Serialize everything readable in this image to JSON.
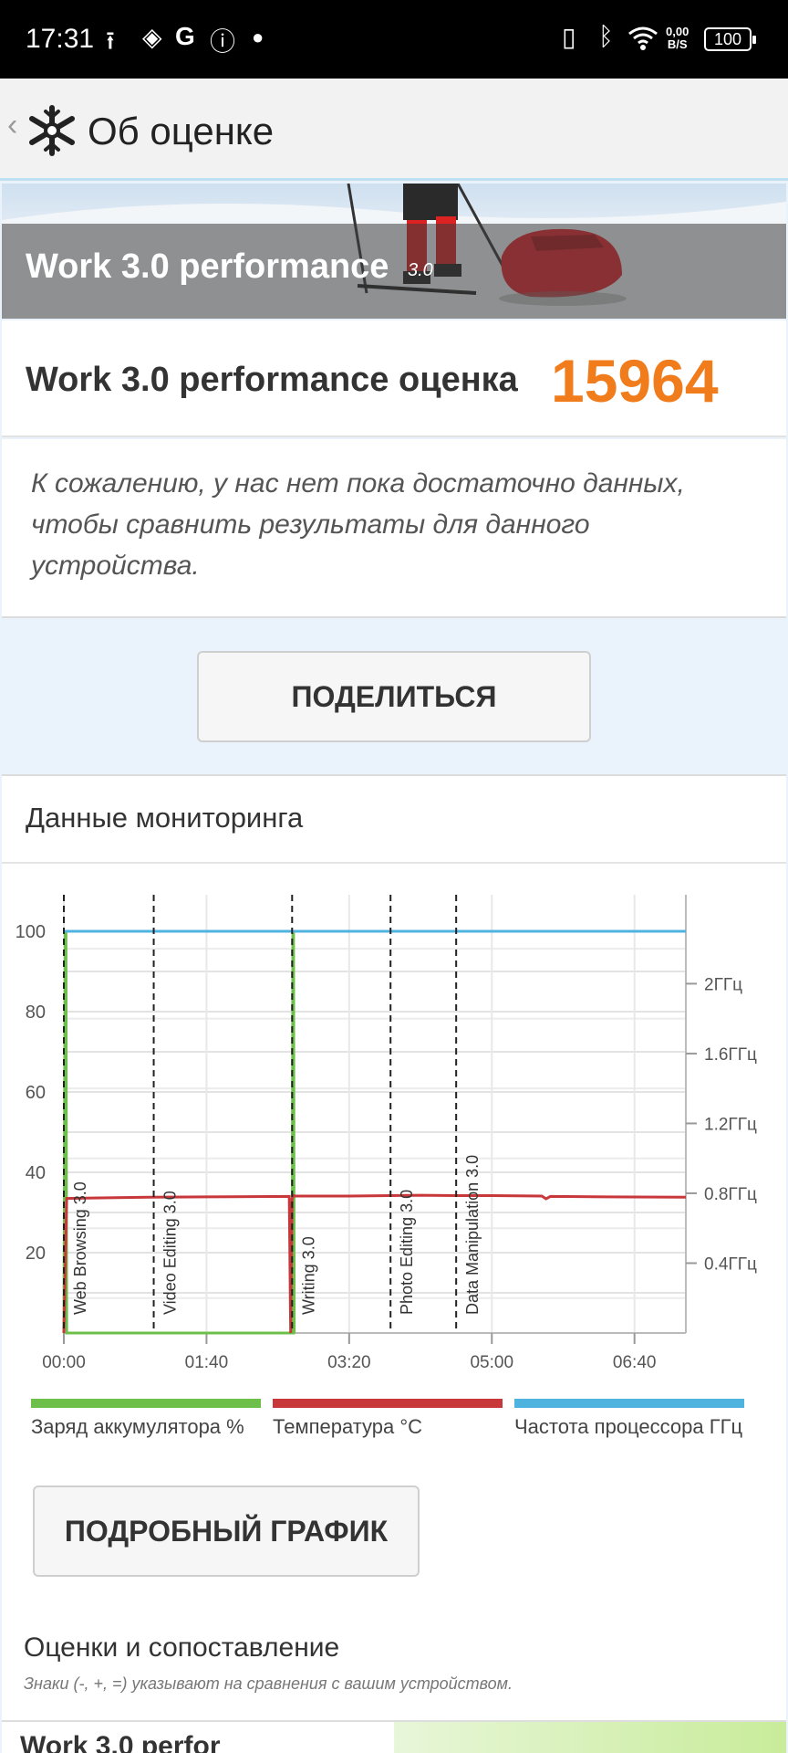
{
  "status_bar": {
    "time": "17:31",
    "net_speed_value": "0,00",
    "net_speed_unit": "B/S",
    "battery": "100",
    "icons": [
      "upload-icon",
      "drive-icon",
      "google-icon",
      "info-icon",
      "dot-icon",
      "vibrate-icon",
      "bluetooth-icon",
      "wifi-icon"
    ]
  },
  "appbar": {
    "back_glyph": "‹",
    "title": "Об оценке"
  },
  "hero": {
    "title": "Work 3.0 performance",
    "version": "3.0"
  },
  "score": {
    "label": "Work 3.0 performance оценка",
    "value": "15964",
    "color": "#f07c1c"
  },
  "note": {
    "text": "К сожалению, у нас нет пока достаточно данных, чтобы сравнить результаты для данного устройства."
  },
  "share_button": "ПОДЕЛИТЬСЯ",
  "monitoring": {
    "title": "Данные мониторинга"
  },
  "chart_data": {
    "type": "line",
    "title": "",
    "xlabel": "",
    "ylabel": "",
    "x_unit": "seconds",
    "x_ticks": [
      "00:00",
      "01:40",
      "03:20",
      "05:00",
      "06:40"
    ],
    "x_tick_values": [
      0,
      100,
      200,
      300,
      400
    ],
    "xlim": [
      0,
      436
    ],
    "ylim": [
      0,
      100
    ],
    "y_ticks": [
      20,
      40,
      60,
      80,
      100
    ],
    "y2_ticks": [
      "0.4ГГц",
      "0.8ГГц",
      "1.2ГГц",
      "1.6ГГц",
      "2ГГц"
    ],
    "y2_tick_values": [
      0.4,
      0.8,
      1.2,
      1.6,
      2.0
    ],
    "y2lim": [
      0,
      2.3
    ],
    "grid": true,
    "markers": [
      {
        "x": 0,
        "label": "Web Browsing 3.0"
      },
      {
        "x": 63,
        "label": "Video Editing 3.0"
      },
      {
        "x": 160,
        "label": "Writing 3.0"
      },
      {
        "x": 229,
        "label": "Photo Editing 3.0"
      },
      {
        "x": 275,
        "label": "Data Manipulation 3.0"
      }
    ],
    "series": [
      {
        "name": "Заряд аккумулятора %",
        "color": "#6cc04a",
        "axis": "left",
        "x": [
          0,
          1,
          1.5,
          2,
          160,
          160.5,
          161,
          161.5,
          162
        ],
        "y": [
          0,
          100,
          100,
          0,
          0,
          100,
          100,
          0,
          0
        ]
      },
      {
        "name": "Температура °C",
        "color": "#c8383a",
        "axis": "left",
        "x": [
          0,
          2,
          20,
          60,
          100,
          158,
          159,
          160,
          161,
          162,
          200,
          250,
          275,
          300,
          335,
          338,
          341,
          380,
          436
        ],
        "y": [
          0,
          33.5,
          33.6,
          33.8,
          33.9,
          34,
          0,
          33.5,
          34.2,
          34.1,
          34.1,
          34.3,
          34.2,
          34.2,
          34.1,
          33.4,
          34.0,
          33.9,
          33.8
        ]
      },
      {
        "name": "Частота процессора ГГц",
        "color": "#4fb3e0",
        "axis": "left",
        "x": [
          0,
          436
        ],
        "y": [
          100,
          100
        ]
      }
    ]
  },
  "legend": [
    {
      "label": "Заряд аккумулятора %",
      "color": "#6cc04a"
    },
    {
      "label": "Температура °C",
      "color": "#c8383a"
    },
    {
      "label": "Частота процессора ГГц",
      "color": "#4fb3e0"
    }
  ],
  "detail_button": "ПОДРОБНЫЙ ГРАФИК",
  "comparison": {
    "title": "Оценки и сопоставление",
    "subtitle": "Знаки (-, +, =) указывают на сравнения с вашим устройством."
  },
  "bottom_partial": "Work 3.0 perfor"
}
